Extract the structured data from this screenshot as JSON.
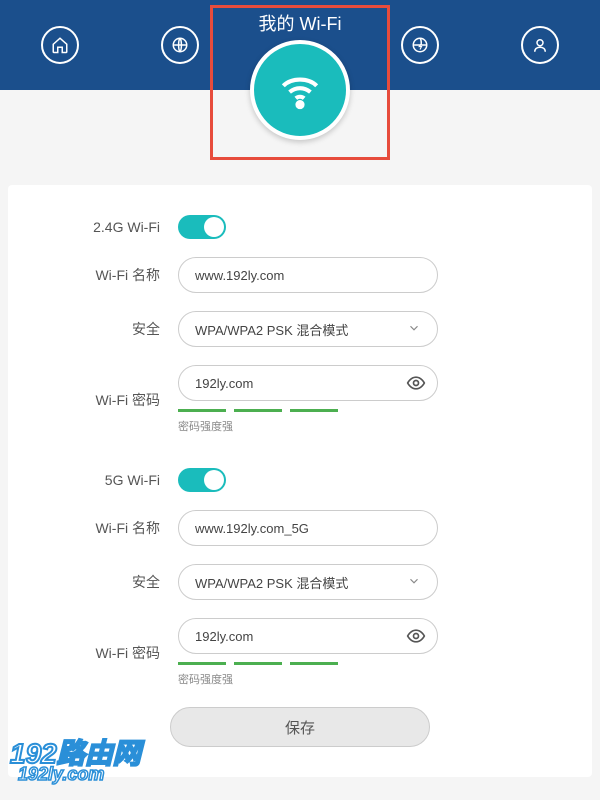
{
  "header": {
    "title": "我的 Wi-Fi"
  },
  "wifi24": {
    "toggle_label": "2.4G Wi-Fi",
    "name_label": "Wi-Fi 名称",
    "name_value": "www.192ly.com",
    "security_label": "安全",
    "security_value": "WPA/WPA2 PSK 混合模式",
    "password_label": "Wi-Fi 密码",
    "password_value": "192ly.com",
    "strength_text": "密码强度强"
  },
  "wifi5": {
    "toggle_label": "5G Wi-Fi",
    "name_label": "Wi-Fi 名称",
    "name_value": "www.192ly.com_5G",
    "security_label": "安全",
    "security_value": "WPA/WPA2 PSK 混合模式",
    "password_label": "Wi-Fi 密码",
    "password_value": "192ly.com",
    "strength_text": "密码强度强"
  },
  "save_label": "保存",
  "watermark": {
    "line1": "192路由网",
    "line2": "192ly.com"
  },
  "colors": {
    "header_bg": "#1b4f8c",
    "accent": "#1abcbc",
    "highlight": "#e74c3c",
    "strength": "#4caf50"
  }
}
